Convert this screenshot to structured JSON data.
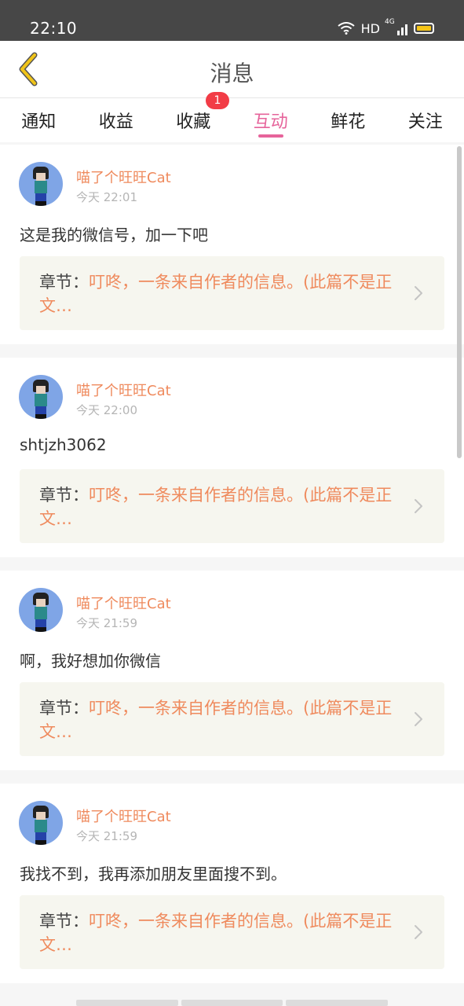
{
  "status_bar": {
    "time": "22:10",
    "network": "HD",
    "signal": "4G"
  },
  "header": {
    "title": "消息"
  },
  "tabs": [
    {
      "label": "通知",
      "active": false
    },
    {
      "label": "收益",
      "active": false
    },
    {
      "label": "收藏",
      "active": false,
      "badge": "1"
    },
    {
      "label": "互动",
      "active": true
    },
    {
      "label": "鲜花",
      "active": false
    },
    {
      "label": "关注",
      "active": false
    }
  ],
  "chapter_label": "章节：",
  "messages": [
    {
      "user": "喵了个旺旺Cat",
      "time": "今天 22:01",
      "content": "这是我的微信号，加一下吧",
      "chapter": "叮咚，一条来自作者的信息。(此篇不是正文…"
    },
    {
      "user": "喵了个旺旺Cat",
      "time": "今天 22:00",
      "content": "shtjzh3062",
      "chapter": "叮咚，一条来自作者的信息。(此篇不是正文…"
    },
    {
      "user": "喵了个旺旺Cat",
      "time": "今天 21:59",
      "content": "啊，我好想加你微信",
      "chapter": "叮咚，一条来自作者的信息。(此篇不是正文…"
    },
    {
      "user": "喵了个旺旺Cat",
      "time": "今天 21:59",
      "content": "我找不到，我再添加朋友里面搜不到。",
      "chapter": "叮咚，一条来自作者的信息。(此篇不是正文…"
    }
  ],
  "colors": {
    "accent": "#e6649b",
    "username": "#ef8a5d",
    "badge": "#f23c46",
    "back_arrow": "#f0c419"
  }
}
